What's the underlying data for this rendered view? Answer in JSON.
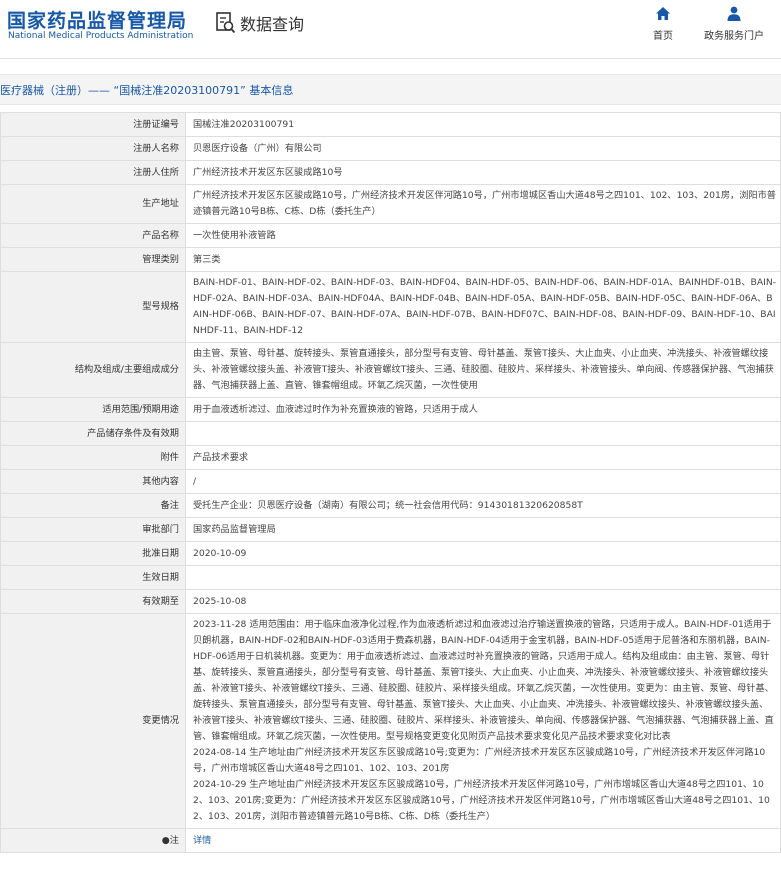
{
  "header": {
    "brand_cn": "国家药品监督管理局",
    "brand_en": "National Medical Products Administration",
    "search_label": "数据查询",
    "nav": [
      {
        "label": "首页",
        "icon": "home-icon"
      },
      {
        "label": "政务服务门户",
        "icon": "user-icon"
      }
    ],
    "accent": "#1758a8"
  },
  "breadcrumb": "医疗器械（注册）—— “国械注准20203100791” 基本信息",
  "rows": [
    {
      "label": "注册证编号",
      "value": "国械注准20203100791"
    },
    {
      "label": "注册人名称",
      "value": "贝恩医疗设备（广州）有限公司"
    },
    {
      "label": "注册人住所",
      "value": "广州经济技术开发区东区骏成路10号"
    },
    {
      "label": "生产地址",
      "value": "广州经济技术开发区东区骏成路10号，广州经济技术开发区伴河路10号，广州市增城区香山大道48号之四101、102、103、201房，浏阳市普迹镇普元路10号B栋、C栋、D栋（委托生产）"
    },
    {
      "label": "产品名称",
      "value": "一次性使用补液管路"
    },
    {
      "label": "管理类别",
      "value": "第三类"
    },
    {
      "label": "型号规格",
      "value": "BAIN-HDF-01、BAIN-HDF-02、BAIN-HDF-03、BAIN-HDF04、BAIN-HDF-05、BAIN-HDF-06、BAIN-HDF-01A、BAINHDF-01B、BAIN-HDF-02A、BAIN-HDF-03A、BAIN-HDF04A、BAIN-HDF-04B、BAIN-HDF-05A、BAIN-HDF-05B、BAIN-HDF-05C、BAIN-HDF-06A、BAIN-HDF-06B、BAIN-HDF-07、BAIN-HDF-07A、BAIN-HDF-07B、BAIN-HDF07C、BAIN-HDF-08、BAIN-HDF-09、BAIN-HDF-10、BAINHDF-11、BAIN-HDF-12"
    },
    {
      "label": "结构及组成/主要组成成分",
      "value": "由主管、泵管、母针基、旋转接头、泵管直通接头，部分型号有支管、母针基盖、泵管T接头、大止血夹、小止血夹、冲洗接头、补液管螺纹接头、补液管螺纹接头盖、补液管T接头、补液管螺纹T接头、三通、硅胶圈、硅胶片、采样接头、补液管接头、单向阀、传感器保护器、气泡捕获器、气泡捕获器上盖、直管、锥套帽组成。环氧乙烷灭菌，一次性使用"
    },
    {
      "label": "适用范围/预期用途",
      "value": "用于血液透析滤过、血液滤过时作为补充置换液的管路，只适用于成人"
    },
    {
      "label": "产品储存条件及有效期",
      "value": ""
    },
    {
      "label": "附件",
      "value": "产品技术要求"
    },
    {
      "label": "其他内容",
      "value": "/"
    },
    {
      "label": "备注",
      "value": "受托生产企业：贝恩医疗设备（湖南）有限公司；统一社会信用代码：91430181320620858T"
    },
    {
      "label": "审批部门",
      "value": "国家药品监督管理局"
    },
    {
      "label": "批准日期",
      "value": "2020-10-09"
    },
    {
      "label": "生效日期",
      "value": ""
    },
    {
      "label": "有效期至",
      "value": "2025-10-08"
    },
    {
      "label": "变更情况",
      "value": "2023-11-28 适用范围由：用于临床血液净化过程,作为血液透析滤过和血液滤过治疗输送置换液的管路，只适用于成人。BAIN-HDF-01适用于贝朗机器，BAIN-HDF-02和BAIN-HDF-03适用于费森机器，BAIN-HDF-04适用于金宝机器，BAIN-HDF-05适用于尼普洛和东丽机器，BAIN-HDF-06适用于日机装机器。变更为：用于血液透析滤过、血液滤过时补充置换液的管路，只适用于成人。结构及组成由：由主管、泵管、母针基、旋转接头、泵管直通接头，部分型号有支管、母针基盖、泵管T接头、大止血夹、小止血夹、冲洗接头、补液管螺纹接头、补液管螺纹接头盖、补液管T接头、补液管螺纹T接头、三通、硅胶圈、硅胶片、采样接头组成。环氧乙烷灭菌，一次性使用。变更为：由主管、泵管、母针基、旋转接头、泵管直通接头，部分型号有支管、母针基盖、泵管T接头、大止血夹、小止血夹、冲洗接头、补液管螺纹接头、补液管螺纹接头盖、补液管T接头、补液管螺纹T接头、三通、硅胶圈、硅胶片、采样接头、补液管接头、单向阀、传感器保护器、气泡捕获器、气泡捕获器上盖、直管、锥套帽组成。环氧乙烷灭菌，一次性使用。型号规格变更变化见附页产品技术要求变化见产品技术要求变化对比表\n2024-08-14 生产地址由广州经济技术开发区东区骏成路10号;变更为：广州经济技术开发区东区骏成路10号，广州经济技术开发区伴河路10号，广州市增城区香山大道48号之四101、102、103、201房\n2024-10-29 生产地址由广州经济技术开发区东区骏成路10号，广州经济技术开发区伴河路10号，广州市增城区香山大道48号之四101、102、103、201房;变更为：广州经济技术开发区东区骏成路10号，广州经济技术开发区伴河路10号，广州市增城区香山大道48号之四101、102、103、201房，浏阳市普迹镇普元路10号B栋、C栋、D栋（委托生产）"
    },
    {
      "label": "●注",
      "value": "详情"
    }
  ]
}
